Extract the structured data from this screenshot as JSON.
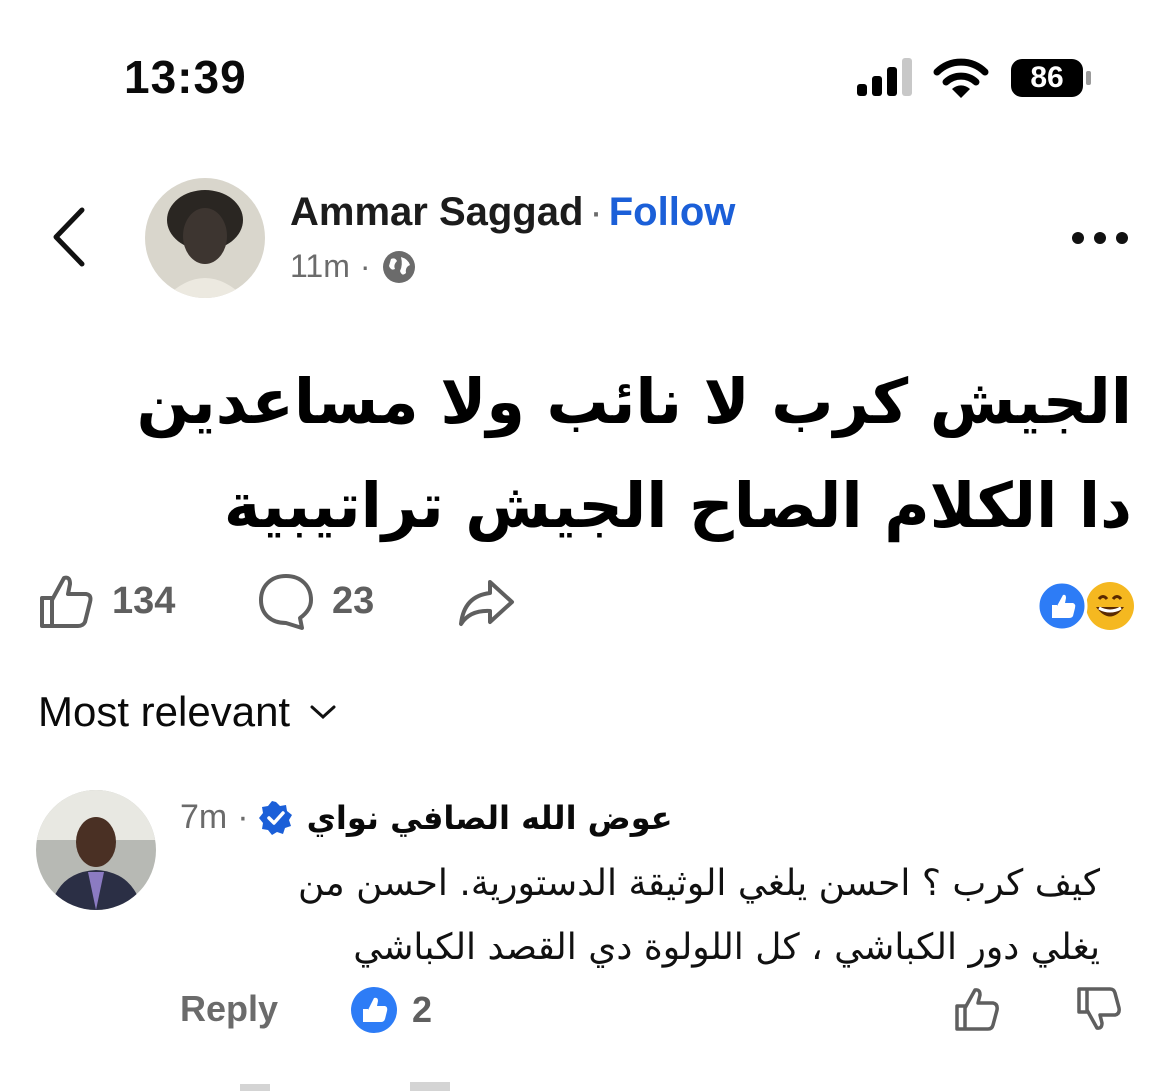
{
  "status_bar": {
    "time": "13:39",
    "battery": "86"
  },
  "post": {
    "author": "Ammar Saggad",
    "separator": "·",
    "follow_label": "Follow",
    "time": "11m",
    "meta_separator": "·",
    "text_line1": "الجيش كرب لا نائب ولا مساعدين",
    "text_line2": "دا الكلام الصاح الجيش تراتيبية",
    "like_count": "134",
    "comment_count": "23"
  },
  "sort": {
    "label": "Most relevant"
  },
  "comment": {
    "author": "عوض الله  الصافي  نواي",
    "time": "7m",
    "separator": "·",
    "text_line1": "كيف كرب ؟ احسن يلغي الوثيقة الدستورية. احسن من",
    "text_line2": "يغلي دور الكباشي ، كل اللولوة دي القصد الكباشي",
    "reply_label": "Reply",
    "reaction_count": "2"
  },
  "colors": {
    "accent": "#1b5fd8",
    "reaction_blue": "#2d7cf6",
    "emoji_yellow": "#f5b820"
  },
  "icons": [
    "back-icon",
    "more-icon",
    "globe-icon",
    "like-icon",
    "comment-icon",
    "share-icon",
    "verified-icon",
    "dislike-icon",
    "chevron-down-icon"
  ]
}
